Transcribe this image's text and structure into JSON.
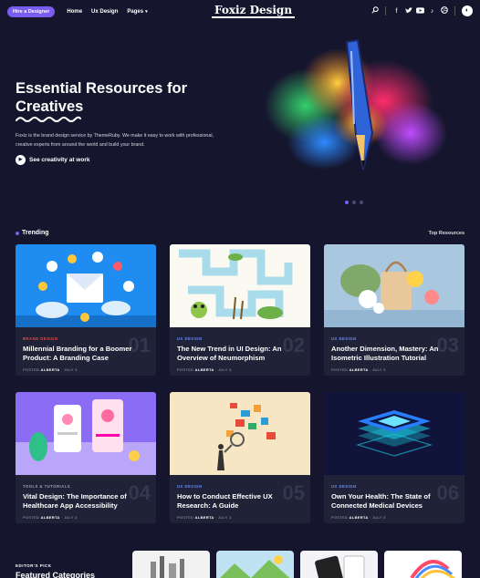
{
  "header": {
    "hire_button": "Hire a Designer",
    "nav": [
      "Home",
      "Ux Design",
      "Pages"
    ],
    "logo": "Foxiz Design",
    "social_icons": [
      "search-icon",
      "facebook-icon",
      "twitter-icon",
      "youtube-icon",
      "tiktok-icon",
      "dribbble-icon",
      "theme-toggle-icon"
    ]
  },
  "hero": {
    "title": "Essential Resources for Creatives",
    "description": "Foxiz is the brand design service by ThemeRuby. We make it easy to work with professional, creative experts from around the world and build your brand.",
    "cta": "See creativity at work",
    "slides": 3,
    "active_slide": 1
  },
  "trending": {
    "heading": "Trending",
    "link": "Top Resources",
    "cards": [
      {
        "category": "BRAND DESIGN",
        "title": "Millennial Branding for a Boomer Product: A Branding Case",
        "num": "01",
        "posted": "POSTED",
        "author": "ALBERTA",
        "date": "JULY 3"
      },
      {
        "category": "UX DESIGN",
        "title": "The New Trend in UI Design: An Overview of Neumorphism",
        "num": "02",
        "posted": "POSTED",
        "author": "ALBERTA",
        "date": "JULY 3"
      },
      {
        "category": "UX DESIGN",
        "title": "Another Dimension, Mastery: An Isometric Illustration Tutorial",
        "num": "03",
        "posted": "POSTED",
        "author": "ALBERTA",
        "date": "JULY 3"
      },
      {
        "category": "TOOLS & TUTORIALS",
        "title": "Vital Design: The Importance of Healthcare App Accessibility",
        "num": "04",
        "posted": "POSTED",
        "author": "ALBERTA",
        "date": "JULY 3"
      },
      {
        "category": "UX DESIGN",
        "title": "How to Conduct Effective UX Research: A Guide",
        "num": "05",
        "posted": "POSTED",
        "author": "ALBERTA",
        "date": "JULY 3"
      },
      {
        "category": "UX DESIGN",
        "title": "Own Your Health: The State of Connected Medical Devices",
        "num": "06",
        "posted": "POSTED",
        "author": "ALBERTA",
        "date": "JULY 3"
      }
    ]
  },
  "editors_pick": {
    "label": "EDITOR'S PICK",
    "heading": "Featured Categories"
  },
  "colors": {
    "background": "#15162e",
    "accent": "#7b5cf0",
    "card": "#202238",
    "brand_category": "#e24a4a",
    "ux_category": "#6d8cff"
  }
}
